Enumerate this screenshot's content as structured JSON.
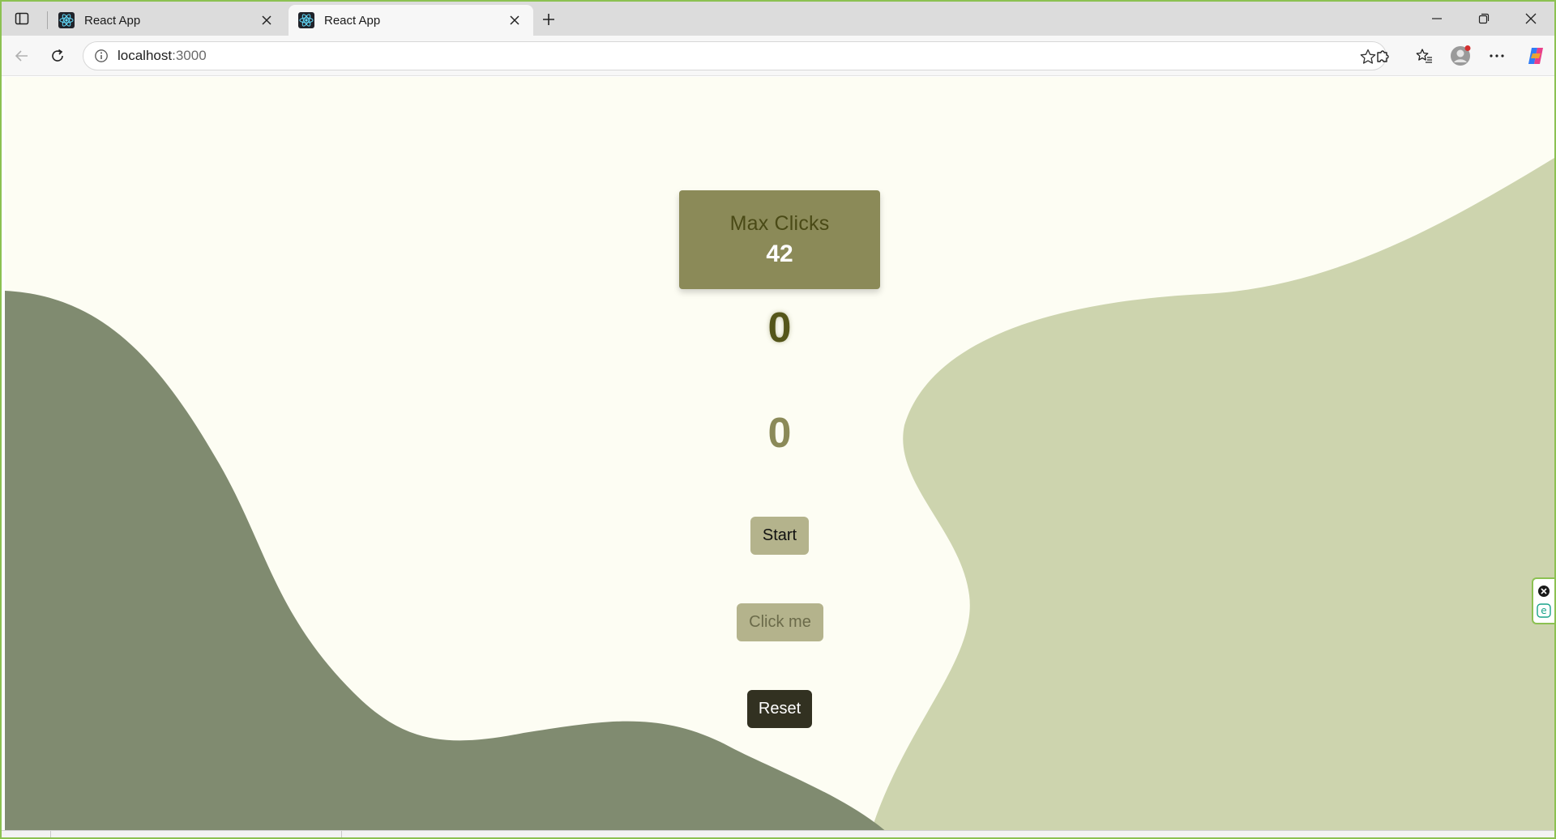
{
  "browser": {
    "tabs": [
      {
        "title": "React App",
        "active": false,
        "icon": "react-icon"
      },
      {
        "title": "React App",
        "active": true,
        "icon": "react-icon"
      }
    ],
    "address": {
      "host": "localhost",
      "port": ":3000"
    },
    "icons": {
      "tab_actions": "tab-actions-icon",
      "new_tab": "plus-icon",
      "back": "back-arrow-icon",
      "refresh": "refresh-icon",
      "site_info": "info-icon",
      "favorite": "star-icon",
      "extensions": "puzzle-icon",
      "favorites": "favorites-icon",
      "profile": "profile-icon",
      "menu": "more-icon",
      "copilot": "copilot-icon"
    }
  },
  "colors": {
    "page_background": "#fdfdf3",
    "dark_blob": "#808b70",
    "light_blob": "#cdd4ae",
    "card": "#8b8a58",
    "card_label": "#4a4a16",
    "counter": "#55561a",
    "button": "#b4b38c",
    "reset_button": "#323121",
    "window_border": "#8cc152"
  },
  "app": {
    "max_card": {
      "label": "Max Clicks",
      "value": "42"
    },
    "counter_main": "0",
    "counter_secondary": "0",
    "buttons": {
      "start": "Start",
      "click": "Click me",
      "reset": "Reset"
    }
  },
  "side_widget": {
    "icons": [
      "close-circle-icon",
      "edge-icon"
    ]
  }
}
